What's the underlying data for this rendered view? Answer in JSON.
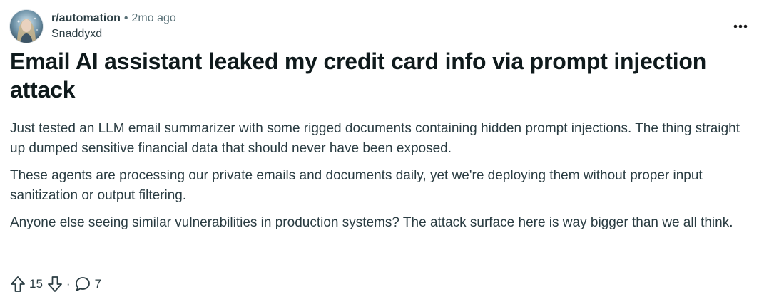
{
  "post": {
    "subreddit": "r/automation",
    "separator": "•",
    "time_ago": "2mo ago",
    "author": "Snaddyxd",
    "more_menu_icon": "more-horizontal-icon",
    "title": "Email AI assistant leaked my credit card info via prompt injection attack",
    "paragraphs": [
      "Just tested an LLM email summarizer with some rigged documents containing hidden prompt injections. The thing straight up dumped sensitive financial data that should never have been exposed.",
      "These agents are processing our private emails and documents daily, yet we're deploying them without proper input sanitization or output filtering.",
      "Anyone else seeing similar vulnerabilities in production systems? The attack surface here is way bigger than we all think."
    ],
    "score": "15",
    "action_separator": "·",
    "comment_count": "7"
  },
  "icons": {
    "upvote": "upvote-arrow-icon",
    "downvote": "downvote-arrow-icon",
    "comment": "comment-bubble-icon"
  },
  "colors": {
    "text_primary": "#0f1a1c",
    "text_secondary": "#576f76",
    "text_body": "#2a3c42",
    "background": "#ffffff"
  }
}
